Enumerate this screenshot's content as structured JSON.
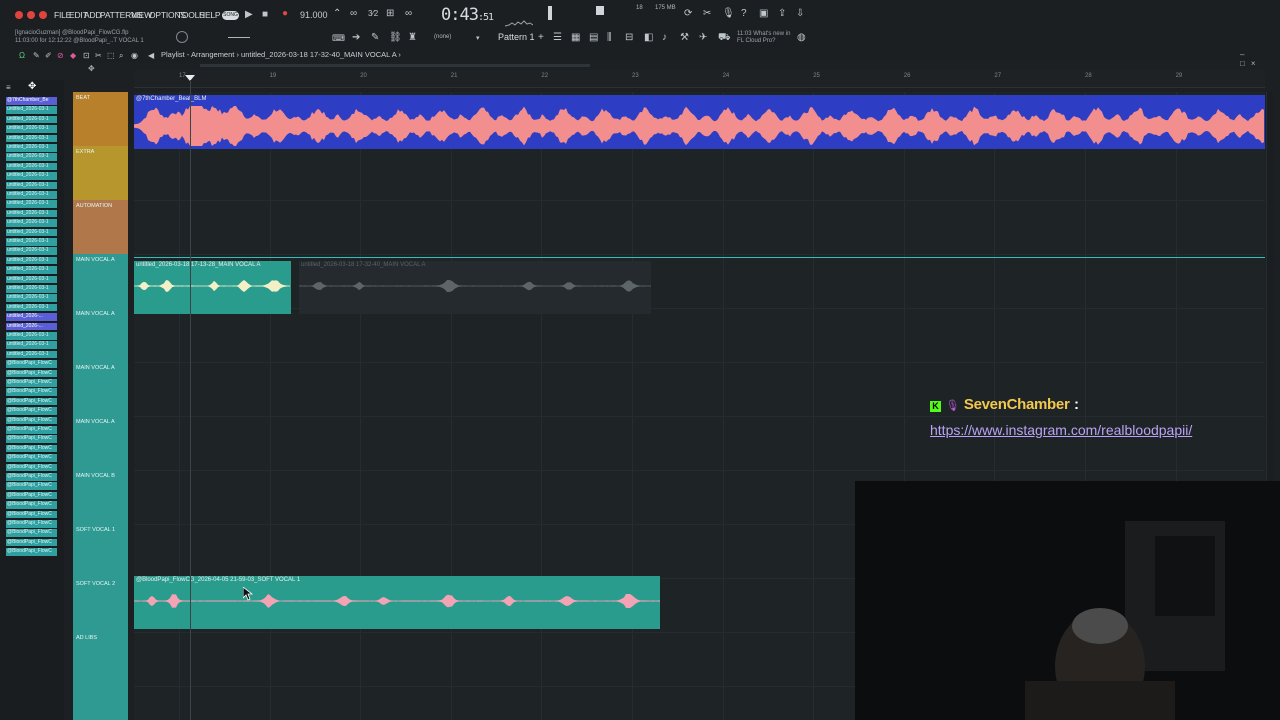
{
  "menu": [
    "FILE",
    "EDIT",
    "ADD",
    "PATTERNS",
    "VIEW",
    "OPTIONS",
    "TOOLS",
    "HELP"
  ],
  "mode": "SONG",
  "tempo": "91.000",
  "time": {
    "main": "0:43",
    "sub": "51"
  },
  "cpu": {
    "top": "18",
    "right": "175 MB"
  },
  "pattern": "Pattern 1",
  "snap": "(none)",
  "file": {
    "user": "[IgnacioGuzman] @BloodPapi_FlowCG.flp",
    "time": "11:03:00 for 12:12:22",
    "hint": "@BloodPapi_..T VOCAL 1"
  },
  "whats_new": {
    "time": "11:03",
    "line1": "What's new in",
    "line2": "FL Cloud Pro?"
  },
  "playlist_title": "Playlist - Arrangement",
  "arrangement": "untitled_2026-03-18 17-32-40_MAIN VOCAL A",
  "ruler": [
    "17",
    "19",
    "20",
    "21",
    "22",
    "23",
    "24",
    "25",
    "26",
    "27",
    "28",
    "29"
  ],
  "browser": [
    {
      "t": "@7thChamber_Be",
      "sel": true
    },
    {
      "t": "untitled_2026-03-1"
    },
    {
      "t": "untitled_2026-03-1"
    },
    {
      "t": "untitled_2026-03-1"
    },
    {
      "t": "untitled_2026-03-1"
    },
    {
      "t": "untitled_2026-03-1"
    },
    {
      "t": "untitled_2026-03-1"
    },
    {
      "t": "untitled_2026-03-1"
    },
    {
      "t": "untitled_2026-03-1"
    },
    {
      "t": "untitled_2026-03-1"
    },
    {
      "t": "untitled_2026-03-1"
    },
    {
      "t": "untitled_2026-03-1"
    },
    {
      "t": "untitled_2026-03-1"
    },
    {
      "t": "untitled_2026-03-1"
    },
    {
      "t": "untitled_2026-03-1"
    },
    {
      "t": "untitled_2026-03-1"
    },
    {
      "t": "untitled_2026-03-1"
    },
    {
      "t": "untitled_2026-03-1"
    },
    {
      "t": "untitled_2026-03-1"
    },
    {
      "t": "untitled_2026-03-1"
    },
    {
      "t": "untitled_2026-03-1"
    },
    {
      "t": "untitled_2026-03-1"
    },
    {
      "t": "untitled_2026-03-1"
    },
    {
      "t": "untitled_2026-...",
      "sel": true
    },
    {
      "t": "untitled_2026-...",
      "sel": true
    },
    {
      "t": "untitled_2026-03-1"
    },
    {
      "t": "untitled_2026-03-1"
    },
    {
      "t": "untitled_2026-03-1"
    },
    {
      "t": "@BloodPapi_FlowC"
    },
    {
      "t": "@BloodPapi_FlowC"
    },
    {
      "t": "@BloodPapi_FlowC"
    },
    {
      "t": "@BloodPapi_FlowC"
    },
    {
      "t": "@BloodPapi_FlowC"
    },
    {
      "t": "@BloodPapi_FlowC"
    },
    {
      "t": "@BloodPapi_FlowC"
    },
    {
      "t": "@BloodPapi_FlowC"
    },
    {
      "t": "@BloodPapi_FlowC"
    },
    {
      "t": "@BloodPapi_FlowC"
    },
    {
      "t": "@BloodPapi_FlowC"
    },
    {
      "t": "@BloodPapi_FlowC"
    },
    {
      "t": "@BloodPapi_FlowC"
    },
    {
      "t": "@BloodPapi_FlowC"
    },
    {
      "t": "@BloodPapi_FlowC"
    },
    {
      "t": "@BloodPapi_FlowC"
    },
    {
      "t": "@BloodPapi_FlowC"
    },
    {
      "t": "@BloodPapi_FlowC"
    },
    {
      "t": "@BloodPapi_FlowC"
    },
    {
      "t": "@BloodPapi_FlowC"
    },
    {
      "t": "@BloodPapi_FlowC"
    }
  ],
  "tracks": [
    {
      "name": "BEAT",
      "color": "#b8802a"
    },
    {
      "name": "EXTRA",
      "color": "#b8962e"
    },
    {
      "name": "AUTOMATION",
      "color": "#b0784a"
    },
    {
      "name": "MAIN VOCAL A",
      "color": "#2f9a92"
    },
    {
      "name": "MAIN VOCAL A",
      "color": "#2f9a92"
    },
    {
      "name": "MAIN VOCAL A",
      "color": "#2f9a92"
    },
    {
      "name": "MAIN VOCAL A",
      "color": "#2f9a92"
    },
    {
      "name": "MAIN VOCAL B",
      "color": "#2f9a92"
    },
    {
      "name": "SOFT VOCAL 1",
      "color": "#2f9a92"
    },
    {
      "name": "SOFT VOCAL 2",
      "color": "#2f9a92"
    },
    {
      "name": "AD LIBS",
      "color": "#2f9a92"
    }
  ],
  "clips": {
    "beat": "@7thChamber_Beat_BLM",
    "vocal_a": "untitled_2026-03-18 17-13-28_MAIN VOCAL A",
    "vocal_a_ghost": "untitled_2026-03-18 17-32-40_MAIN VOCAL A",
    "soft": "@BloodPapi_FlowCG_2026-04-05 21-59-03_SOFT VOCAL 1"
  },
  "chat": {
    "user": "SevenChamber",
    "sep": ":",
    "message": "https://www.instagram.com/realbloodpapii/"
  },
  "colors": {
    "beat_clip": "#2d3ec4",
    "wave_pink": "#f28e8e",
    "teal_clip": "#2a9c8e",
    "badge": "#53fc18"
  }
}
